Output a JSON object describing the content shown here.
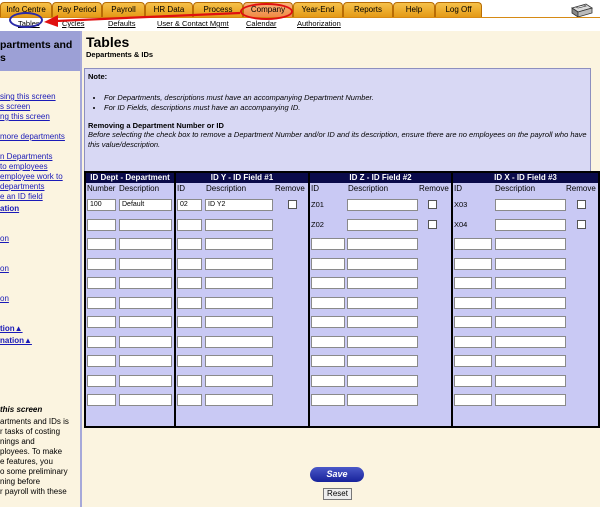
{
  "tabs": [
    "Info Centre",
    "Pay Period",
    "Payroll",
    "HR Data",
    "Process",
    "Company",
    "Year-End",
    "Reports",
    "Help",
    "Log Off"
  ],
  "subnav": [
    "Tables",
    "Cycles",
    "Defaults",
    "User & Contact Mgmt",
    "Calendar",
    "Authorization"
  ],
  "sidebar": {
    "title_line1": "partments and",
    "title_line2": "s",
    "links": [
      "sing this screen",
      "s screen",
      "ng this screen",
      "more departments",
      "n Departments",
      "to employees",
      "employee work to",
      "departments",
      "e an ID field",
      "ation",
      "on",
      "on",
      "on",
      "tion▲",
      "nation▲"
    ],
    "section_title": "this screen",
    "section_text": [
      "artments and IDs is",
      "r tasks of costing",
      "nings and",
      "ployees. To make",
      "e features, you",
      "o some preliminary",
      "ning before",
      "r payroll with these"
    ]
  },
  "page": {
    "title": "Tables",
    "subtitle": "Departments & IDs"
  },
  "note": {
    "label": "Note:",
    "items": [
      "For Departments, descriptions must have an accompanying Department Number.",
      "For ID Fields, descriptions must have an accompanying ID."
    ],
    "remove_heading": "Removing a Department Number or ID",
    "remove_text": "Before selecting the check box to remove a Department Number and/or ID and its description, ensure there are no employees on the payroll who have this value/description."
  },
  "grid": {
    "dept": {
      "title": "ID Dept - Department",
      "col_number": "Number",
      "col_description": "Description",
      "rows": [
        {
          "number": "100",
          "description": "Default"
        }
      ]
    },
    "idy": {
      "title": "ID Y - ID Field #1",
      "col_id": "ID",
      "col_description": "Description",
      "col_remove": "Remove",
      "rows": [
        {
          "id": "02",
          "description": "ID Y2"
        }
      ]
    },
    "idz": {
      "title": "ID Z - ID Field #2",
      "col_id": "ID",
      "col_description": "Description",
      "col_remove": "Remove",
      "labels": [
        "Z01",
        "Z02"
      ]
    },
    "idx": {
      "title": "ID X - ID Field #3",
      "col_id": "ID",
      "col_description": "Description",
      "col_remove": "Remove",
      "labels": [
        "X03",
        "X04"
      ]
    }
  },
  "buttons": {
    "save": "Save",
    "reset": "Reset"
  },
  "colors": {
    "tab": "#f0a830",
    "tab_active": "#f08a45",
    "header": "#0a0a4a",
    "panel": "#c9c9f4",
    "bg": "#fbf4e0"
  },
  "icons": [
    "printer-icon"
  ]
}
